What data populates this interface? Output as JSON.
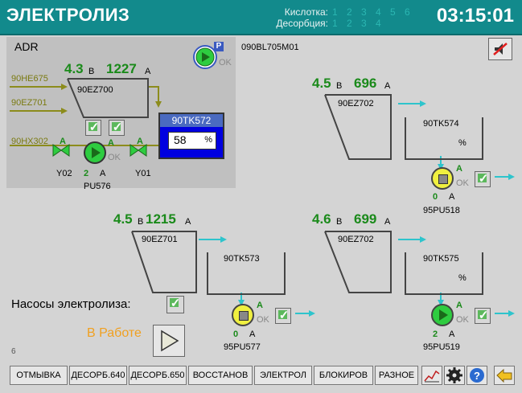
{
  "header": {
    "title": "ЭЛЕКТРОЛИЗ",
    "acid_label": "Кислотка:",
    "acid_numbers": [
      "1",
      "2",
      "3",
      "4",
      "5",
      "6"
    ],
    "desorption_label": "Десорбция:",
    "desorption_numbers": [
      "1",
      "2",
      "3",
      "4"
    ],
    "clock": "03:15:01"
  },
  "colors": {
    "header_bg": "#128a8c",
    "value_green": "#1a8a1a",
    "pipe_olive": "#8c8c1c",
    "pipe_cyan": "#2ec4cc",
    "tank_blue": "#0000e0",
    "tank_header": "#4a6ac0",
    "status_orange": "#f0a020"
  },
  "adr": {
    "title": "ADR",
    "pump_badge": "P",
    "pump_ok": "OK",
    "inputs": [
      "90HE675",
      "90EZ701",
      "90HX302"
    ],
    "voltage": "4.3",
    "voltage_unit": "В",
    "current": "1227",
    "current_unit": "А",
    "cell": "90EZ700",
    "tank": "90TK572",
    "tank_level": "58",
    "tank_unit": "%",
    "valve_left": "Y02",
    "valve_right": "Y01",
    "valve_state": "A",
    "pump_state": "A",
    "pump_ok2": "OK",
    "pump_count": "2",
    "pump_mode": "A",
    "pump_name": "PU576"
  },
  "tag": "090BL705M01",
  "cells": [
    {
      "voltage": "4.5",
      "voltage_unit": "В",
      "current": "696",
      "current_unit": "А",
      "cell": "90EZ702",
      "tank": "90TK574",
      "tank_unit": "%",
      "pump_state": "A",
      "pump_ok": "OK",
      "pump_count": "0",
      "pump_mode": "A",
      "pump_name": "95PU518",
      "pump_type": "yellow"
    },
    {
      "voltage": "4.5",
      "voltage_unit": "В",
      "current": "1215",
      "current_unit": "А",
      "cell": "90EZ701",
      "tank": "90TK573",
      "tank_unit": "",
      "pump_state": "A",
      "pump_ok": "OK",
      "pump_count": "0",
      "pump_mode": "A",
      "pump_name": "95PU577",
      "pump_type": "yellow"
    },
    {
      "voltage": "4.6",
      "voltage_unit": "В",
      "current": "699",
      "current_unit": "А",
      "cell": "90EZ702",
      "tank": "90TK575",
      "tank_unit": "%",
      "pump_state": "A",
      "pump_ok": "OK",
      "pump_count": "2",
      "pump_mode": "A",
      "pump_name": "95PU519",
      "pump_type": "green"
    }
  ],
  "pumps_label": "Насосы электролиза:",
  "status": "В Работе",
  "page_number": "6",
  "toolbar": {
    "buttons": [
      "ОТМЫВКА",
      "ДЕСОРБ.640",
      "ДЕСОРБ.650",
      "ВОССТАНОВ",
      "ЭЛЕКТРОЛ",
      "БЛОКИРОВ",
      "РАЗНОЕ"
    ],
    "icons": [
      "trend-icon",
      "gear-icon",
      "help-icon",
      "back-arrow-icon"
    ]
  }
}
